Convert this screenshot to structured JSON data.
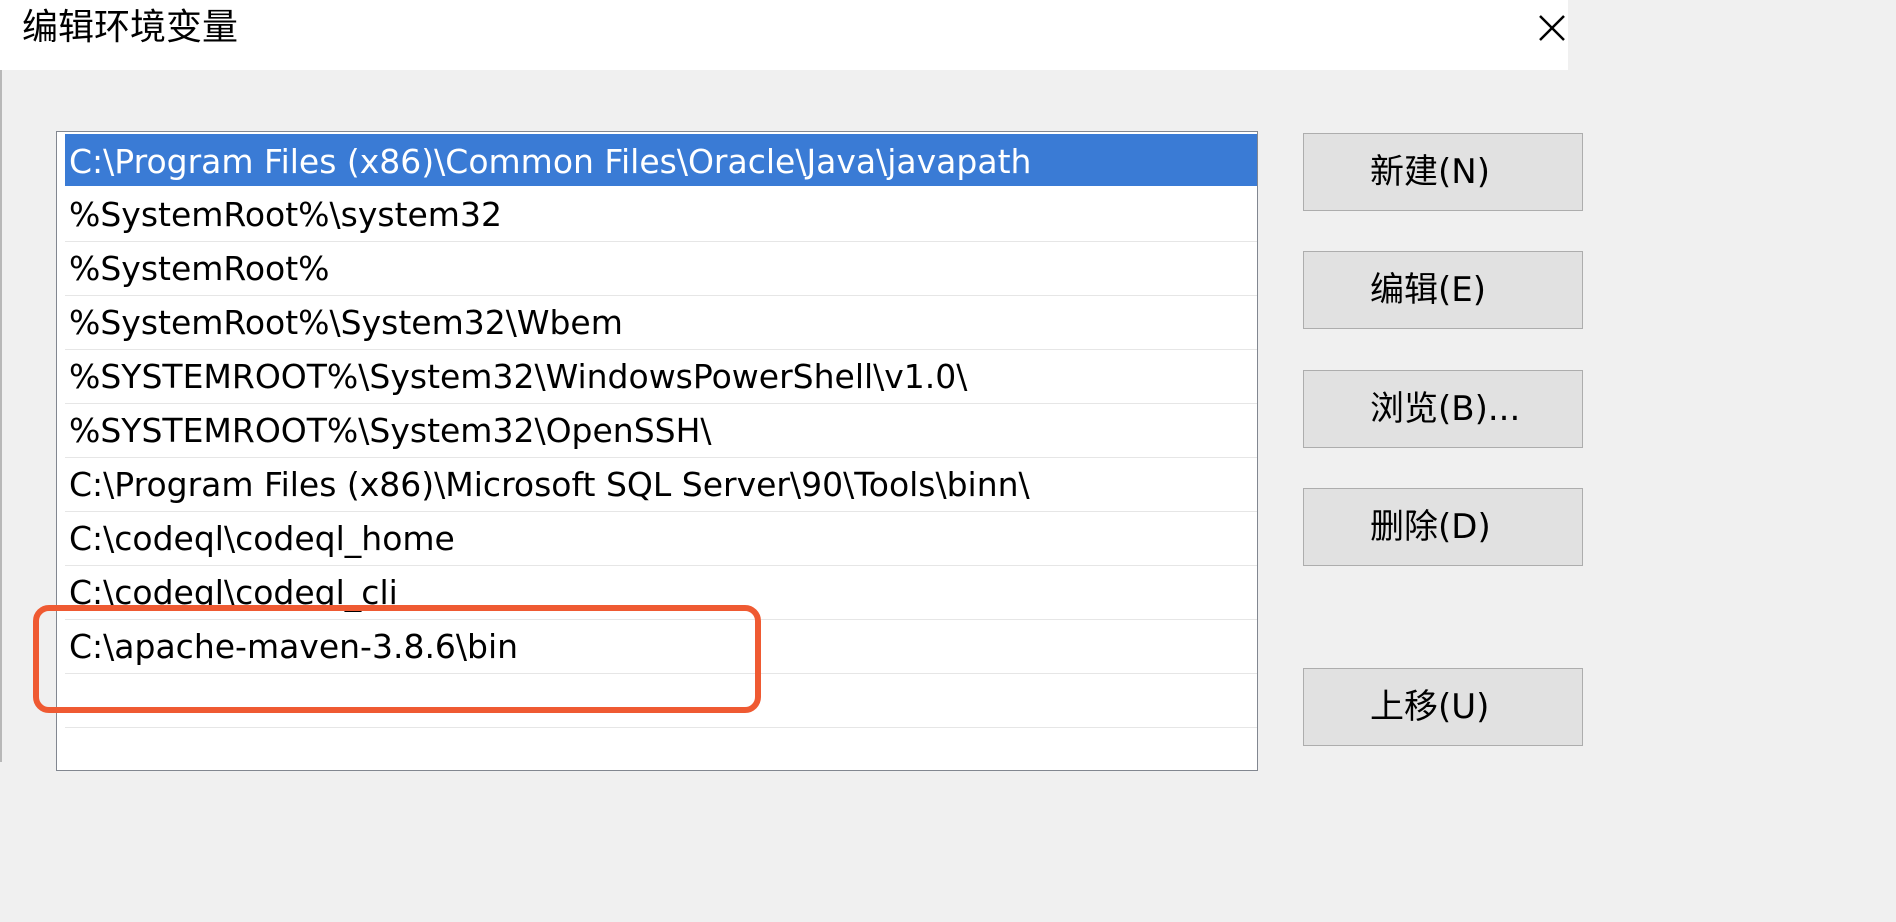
{
  "window": {
    "title": "编辑环境变量",
    "close_glyph": "✕"
  },
  "path_list": {
    "selected_index": 0,
    "items": [
      "C:\\Program Files (x86)\\Common Files\\Oracle\\Java\\javapath",
      "%SystemRoot%\\system32",
      "%SystemRoot%",
      "%SystemRoot%\\System32\\Wbem",
      "%SYSTEMROOT%\\System32\\WindowsPowerShell\\v1.0\\",
      "%SYSTEMROOT%\\System32\\OpenSSH\\",
      "C:\\Program Files (x86)\\Microsoft SQL Server\\90\\Tools\\binn\\",
      "C:\\codeql\\codeql_home",
      "C:\\codeql\\codeql_cli",
      "C:\\apache-maven-3.8.6\\bin",
      ""
    ]
  },
  "buttons": {
    "new_label": "新建(N)",
    "edit_label": "编辑(E)",
    "browse_label": "浏览(B)...",
    "delete_label": "删除(D)",
    "move_up_label": "上移(U)"
  },
  "colors": {
    "selection": "#3a7bd5",
    "annotation": "#ef5a32",
    "dialog_bg": "#f0f0f0"
  }
}
